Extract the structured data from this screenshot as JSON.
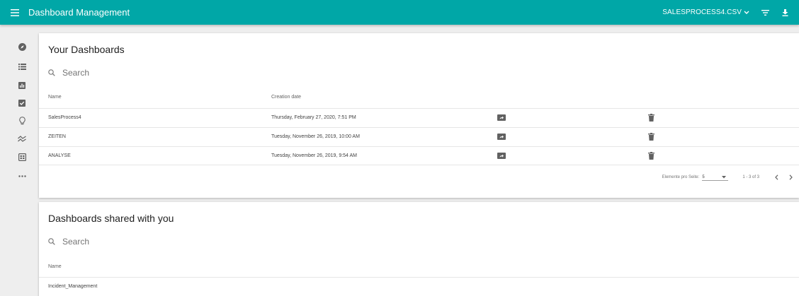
{
  "header": {
    "title": "Dashboard Management",
    "file_name": "SALESPROCESS4.CSV"
  },
  "sidebar": {
    "items": [
      {
        "icon": "compass-icon"
      },
      {
        "icon": "list-icon"
      },
      {
        "icon": "bar-chart-icon"
      },
      {
        "icon": "checkbox-icon"
      },
      {
        "icon": "lightbulb-icon"
      },
      {
        "icon": "trend-icon"
      },
      {
        "icon": "form-icon"
      },
      {
        "icon": "more-icon"
      }
    ]
  },
  "your_dashboards": {
    "title": "Your Dashboards",
    "search_placeholder": "Search",
    "columns": {
      "name": "Name",
      "creation_date": "Creation date"
    },
    "rows": [
      {
        "name": "SalesProcess4",
        "date": "Thursday, February 27, 2020, 7:51 PM"
      },
      {
        "name": "ZEITEN",
        "date": "Tuesday, November 26, 2019, 10:00 AM"
      },
      {
        "name": "ANALYSE",
        "date": "Tuesday, November 26, 2019, 9:54 AM"
      }
    ],
    "paginator": {
      "items_per_page_label": "Elemente pro Seite:",
      "page_size": "5",
      "range": "1 - 3 of 3"
    }
  },
  "shared_dashboards": {
    "title": "Dashboards shared with you",
    "search_placeholder": "Search",
    "columns": {
      "name": "Name"
    },
    "rows": [
      {
        "name": "Incident_Management"
      }
    ]
  }
}
